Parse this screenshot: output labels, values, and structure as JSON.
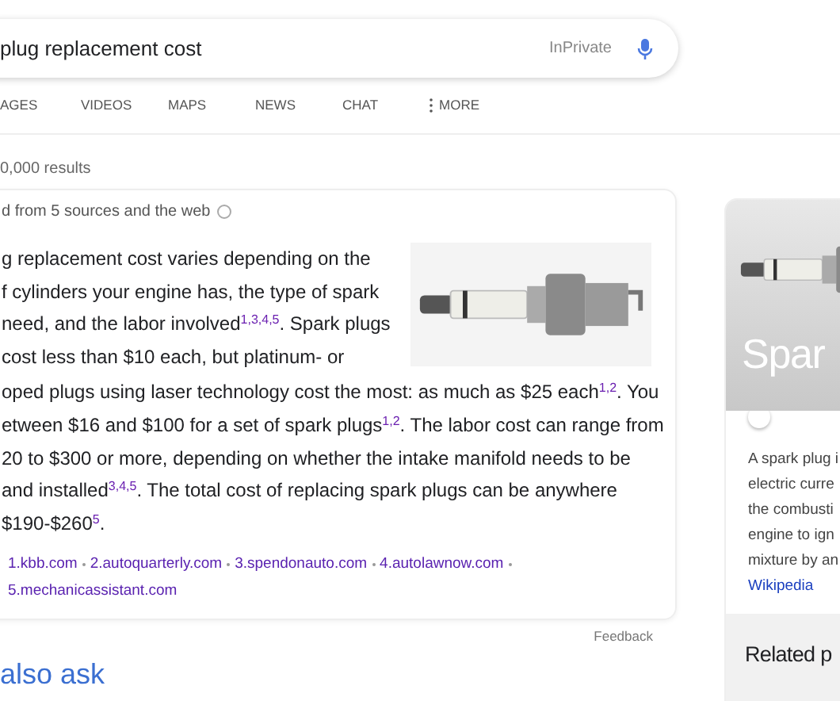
{
  "search": {
    "query": "plug replacement cost",
    "mode": "InPrivate"
  },
  "tabs": [
    {
      "label": "AGES",
      "kind": "plain"
    },
    {
      "label": "VIDEOS",
      "kind": "plain"
    },
    {
      "label": "MAPS",
      "kind": "plain"
    },
    {
      "label": "NEWS",
      "kind": "plain"
    },
    {
      "label": "CHAT",
      "kind": "plain"
    },
    {
      "label": "MORE",
      "kind": "menu"
    }
  ],
  "result_count": "0,000 results",
  "answer": {
    "header": "d from 5 sources and the web",
    "lines_beside_image": [
      "g replacement cost varies depending on the",
      "f cylinders your engine has, the type of spark",
      "need, and the labor involved$^{1,3,4,5}$. Spark plugs",
      "cost less than $10 each, but platinum- or"
    ],
    "lines": [
      "oped plugs using laser technology cost the most: as much as $25 each$^{1,2}$. You",
      "etween $16 and $100 for a set of spark plugs$^{1,2}$. The labor cost can range from",
      "20 to $300 or more, depending on whether the intake manifold needs to be",
      "and installed$^{3,4,5}$. The total cost of replacing spark plugs can be anywhere",
      "$190-$260$^{5}$."
    ],
    "sources": [
      "1.kbb.com",
      "2.autoquarterly.com",
      "3.spendonauto.com",
      "4.autolawnow.com",
      "5.mechanicassistant.com"
    ],
    "feedback": "Feedback"
  },
  "people_also_ask": {
    "title": "also ask"
  },
  "knowledge_panel": {
    "title": "Spar",
    "description_lines": [
      "A spark plug i",
      "electric curre",
      "the combusti",
      "engine to ign",
      "mixture by an"
    ],
    "source": "Wikipedia",
    "related_title": "Related p"
  }
}
